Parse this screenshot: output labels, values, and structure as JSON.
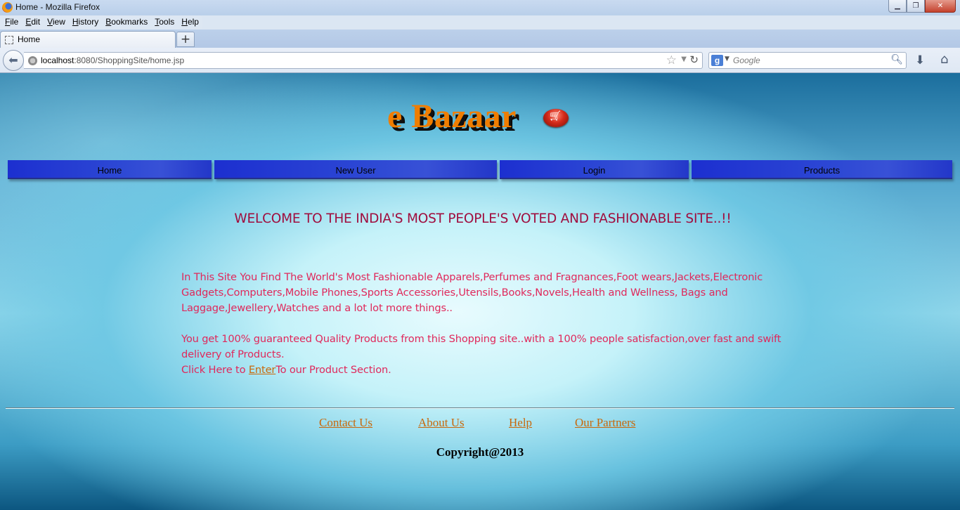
{
  "browser": {
    "window_title": "Home - Mozilla Firefox",
    "menu": [
      "File",
      "Edit",
      "View",
      "History",
      "Bookmarks",
      "Tools",
      "Help"
    ],
    "tab_title": "Home",
    "new_tab_label": "+",
    "url_host": "localhost",
    "url_rest": ":8080/ShoppingSite/home.jsp",
    "search_placeholder": "Google",
    "window_buttons": {
      "minimize": "▁",
      "restore": "❐",
      "close": "✕"
    }
  },
  "site": {
    "logo": "e Bazaar",
    "nav": [
      "Home",
      "New User",
      "Login",
      "Products"
    ],
    "welcome": "WELCOME TO THE INDIA'S MOST PEOPLE'S VOTED AND FASHIONABLE SITE..!!",
    "para1": "In This Site You Find The World's Most Fashionable Apparels,Perfumes and Fragnances,Foot wears,Jackets,Electronic Gadgets,Computers,Mobile Phones,Sports Accessories,Utensils,Books,Novels,Health and Wellness, Bags and Laggage,Jewellery,Watches and a lot lot more things..",
    "para2": "You get 100% guaranteed Quality Products from this Shopping site..with a 100% people satisfaction,over fast and swift delivery of Products.",
    "para3_prefix": "Click Here to ",
    "para3_link": "Enter",
    "para3_suffix": "To our Product Section.",
    "footer_links": [
      "Contact Us",
      "About Us",
      "Help",
      "Our Partners"
    ],
    "copyright": "Copyright@2013"
  },
  "colors": {
    "nav_blue": "#2d48d4",
    "welcome_text": "#a00d3e",
    "body_text": "#e0285b",
    "link": "#c8690c",
    "logo": "#f07d00"
  }
}
